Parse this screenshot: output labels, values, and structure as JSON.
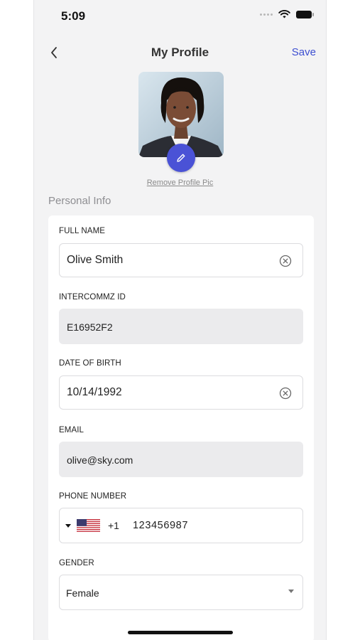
{
  "status_bar": {
    "time": "5:09",
    "icons": [
      "signal-dots-icon",
      "wifi-icon",
      "battery-icon"
    ]
  },
  "nav": {
    "back_icon": "chevron-left-icon",
    "title": "My Profile",
    "save_label": "Save"
  },
  "profile": {
    "remove_pic_label": "Remove Profile Pic",
    "edit_icon": "pencil-icon"
  },
  "section": {
    "title": "Personal Info"
  },
  "fields": {
    "full_name": {
      "label": "FULL NAME",
      "value": "Olive Smith"
    },
    "intercommz_id": {
      "label": "INTERCOMMZ ID",
      "value": "E16952F2"
    },
    "dob": {
      "label": "DATE OF BIRTH",
      "value": "10/14/1992"
    },
    "email": {
      "label": "EMAIL",
      "value": "olive@sky.com"
    },
    "phone": {
      "label": "PHONE NUMBER",
      "country_code": "+1",
      "number": "123456987",
      "flag_icon": "us-flag-icon"
    },
    "gender": {
      "label": "GENDER",
      "value": "Female"
    }
  },
  "colors": {
    "accent": "#4a52d6",
    "link": "#3d4fd1",
    "background": "#f3f3f4",
    "disabled_field": "#ebebed"
  }
}
